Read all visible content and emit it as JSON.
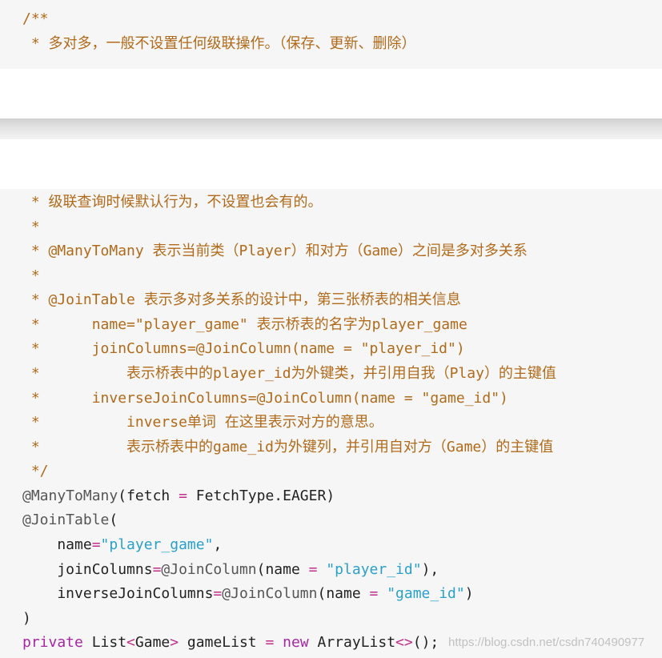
{
  "top_comment": {
    "l1": "/**",
    "l2": " * 多对多，一般不设置任何级联操作。（保存、更新、删除）"
  },
  "comment_lines": [
    " * 级联查询时候默认行为，不设置也会有的。",
    " *",
    " * @ManyToMany 表示当前类（Player）和对方（Game）之间是多对多关系",
    " *",
    " * @JoinTable 表示多对多关系的设计中，第三张桥表的相关信息",
    " *      name=\"player_game\" 表示桥表的名字为player_game",
    " *      joinColumns=@JoinColumn(name = \"player_id\")",
    " *          表示桥表中的player_id为外键类，并引用自我（Play）的主键值",
    " *      inverseJoinColumns=@JoinColumn(name = \"game_id\")",
    " *          inverse单词 在这里表示对方的意思。",
    " *          表示桥表中的game_id为外键列，并引用自对方（Game）的主键值",
    " */"
  ],
  "code": {
    "l1_ann": "@ManyToMany",
    "l1_p1": "(",
    "l1_fetch": "fetch",
    "l1_eq": " = ",
    "l1_val": "FetchType.EAGER",
    "l1_p2": ")",
    "l2_ann": "@JoinTable",
    "l2_p": "(",
    "l3_key": "    name",
    "l3_eq": "=",
    "l3_str": "\"player_game\"",
    "l3_comma": ",",
    "l4_key": "    joinColumns",
    "l4_eq": "=",
    "l4_ann": "@JoinColumn",
    "l4_p1": "(",
    "l4_name": "name",
    "l4_eq2": " = ",
    "l4_str": "\"player_id\"",
    "l4_p2": "),",
    "l5_key": "    inverseJoinColumns",
    "l5_eq": "=",
    "l5_ann": "@JoinColumn",
    "l5_p1": "(",
    "l5_name": "name",
    "l5_eq2": " = ",
    "l5_str": "\"game_id\"",
    "l5_p2": ")",
    "l6": ")",
    "l7_kw1": "private",
    "l7_type": " List",
    "l7_lt": "<",
    "l7_gen": "Game",
    "l7_gt": ">",
    "l7_var": " gameList ",
    "l7_eq": "=",
    "l7_kw2": " new",
    "l7_ctor": " ArrayList",
    "l7_diamond": "<>",
    "l7_end": "();"
  },
  "watermark": "https://blog.csdn.net/csdn740490977",
  "colors": {
    "panel_bg": "#f6f6f6",
    "comment": "#b06a1a",
    "keyword": "#a626a4",
    "string": "#2aa0c8",
    "operator": "#c0308a"
  }
}
